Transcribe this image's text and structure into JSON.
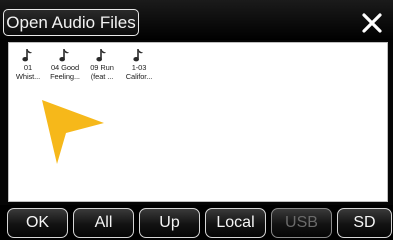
{
  "header": {
    "title": "Open Audio Files",
    "close_icon": "close-icon"
  },
  "files": [
    {
      "line1": "01",
      "line2": "Whist...",
      "icon": "music-note-icon"
    },
    {
      "line1": "04 Good",
      "line2": "Feeling...",
      "icon": "music-note-icon"
    },
    {
      "line1": "09 Run",
      "line2": "(feat ...",
      "icon": "music-note-icon"
    },
    {
      "line1": "1-03",
      "line2": "Califor...",
      "icon": "music-note-icon"
    }
  ],
  "toolbar": {
    "ok": "OK",
    "all": "All",
    "up": "Up",
    "local": "Local",
    "usb": "USB",
    "sd": "SD"
  },
  "colors": {
    "background": "#050505",
    "file_area": "#ffffff",
    "cursor_arrow": "#f6b81a",
    "text": "#f5f5f5",
    "disabled_text": "#6a6a6a"
  }
}
